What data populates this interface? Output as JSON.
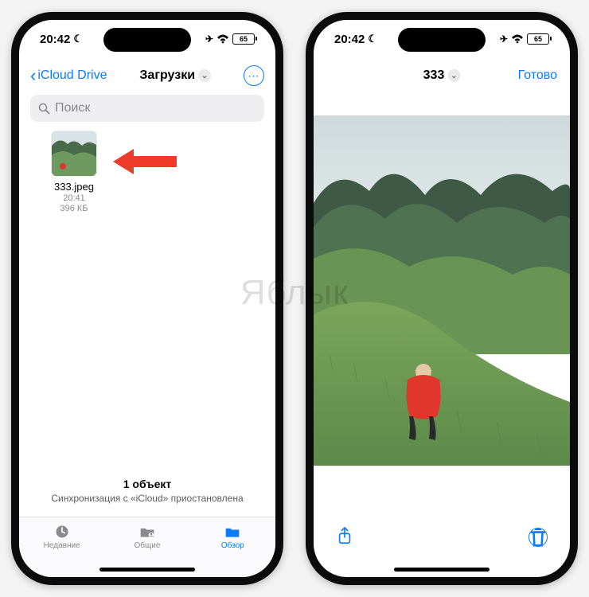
{
  "watermark": "Яблык",
  "status": {
    "time": "20:42",
    "battery": "65"
  },
  "left_phone": {
    "nav": {
      "back_label": "iCloud Drive",
      "title": "Загрузки",
      "more_icon": "more-circle"
    },
    "search": {
      "placeholder": "Поиск"
    },
    "file": {
      "name": "333.jpeg",
      "time": "20:41",
      "size": "396 КБ"
    },
    "footer": {
      "count": "1 объект",
      "sync": "Синхронизация с «iCloud» приостановлена"
    },
    "tabs": {
      "recents": "Недавние",
      "shared": "Общие",
      "browse": "Обзор"
    }
  },
  "right_phone": {
    "nav": {
      "title": "333",
      "done": "Готово"
    }
  }
}
